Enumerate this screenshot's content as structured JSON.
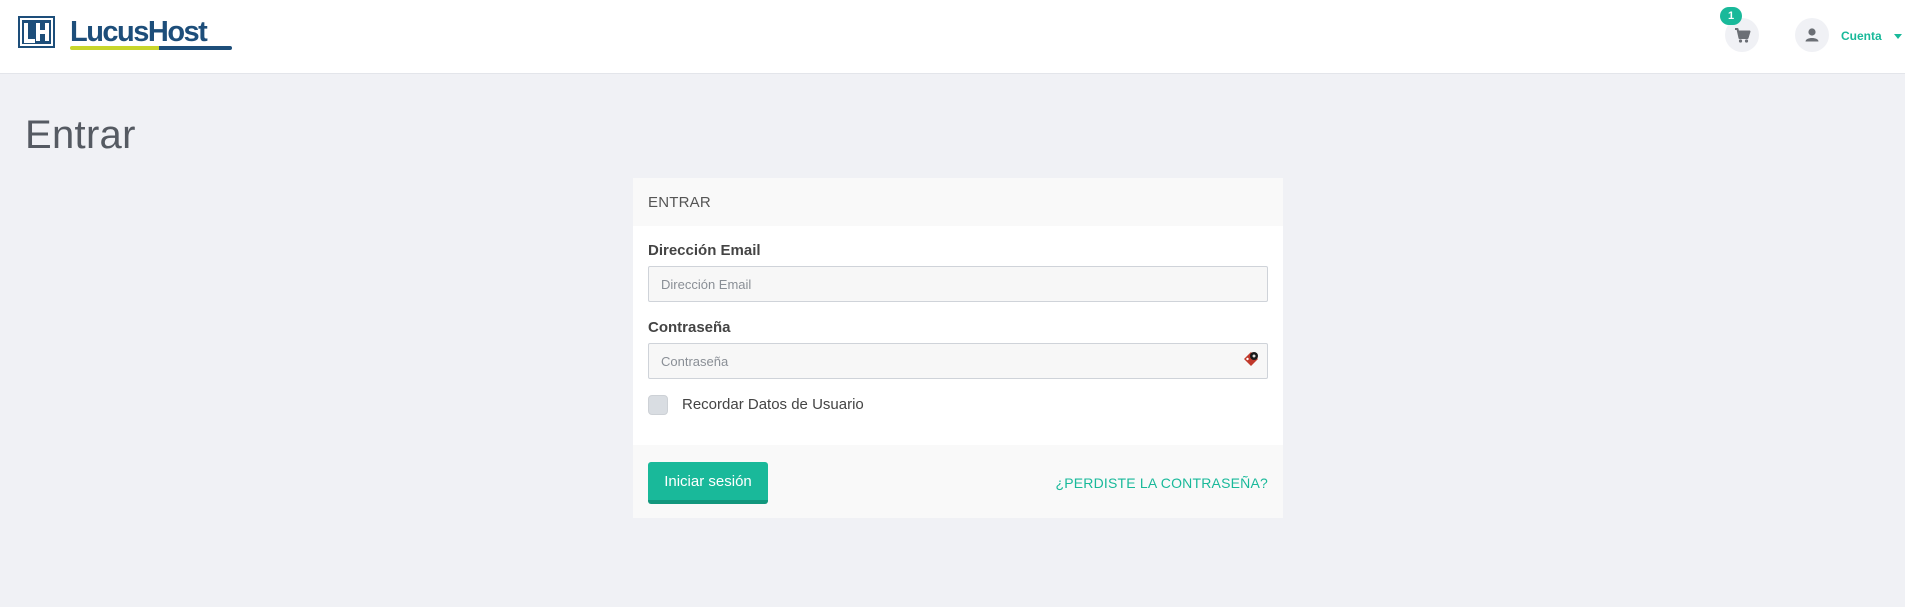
{
  "brand": {
    "name": "LucusHost",
    "mark": "LH",
    "colors": {
      "primary": "#1d4e7a",
      "accent": "#c8d62b",
      "action": "#19b99a"
    }
  },
  "header": {
    "cart": {
      "icon": "cart-icon",
      "count": "1"
    },
    "account": {
      "icon": "user-icon",
      "label": "Cuenta"
    }
  },
  "page": {
    "title": "Entrar"
  },
  "login_card": {
    "header": "ENTRAR",
    "email": {
      "label": "Dirección Email",
      "placeholder": "Dirección Email",
      "value": ""
    },
    "password": {
      "label": "Contraseña",
      "placeholder": "Contraseña",
      "value": ""
    },
    "remember": {
      "label": "Recordar Datos de Usuario",
      "checked": false
    },
    "submit_label": "Iniciar sesión",
    "forgot_label": "¿PERDISTE LA CONTRASEÑA?"
  }
}
